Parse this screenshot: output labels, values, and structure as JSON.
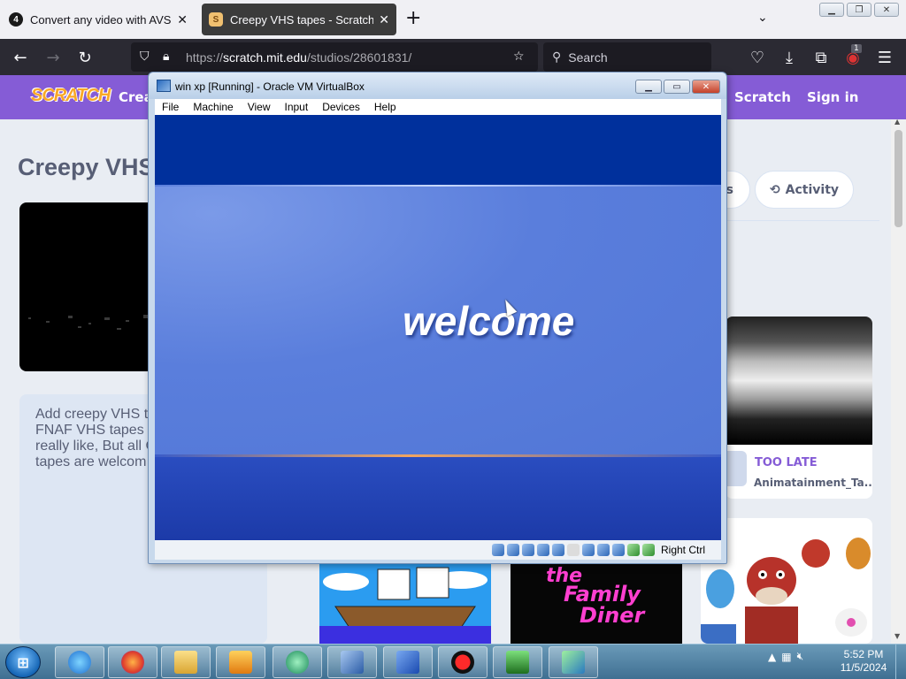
{
  "browser": {
    "tabs": [
      {
        "title": "Convert any video with AVS Fre",
        "favicon": "avs-icon"
      },
      {
        "title": "Creepy VHS tapes - Scratch Stu",
        "favicon": "scratch-icon"
      }
    ],
    "new_tab_label": "+",
    "url_host": "scratch.mit.edu",
    "url_prefix": "https://",
    "url_path": "/studios/28601831/",
    "search_placeholder": "Search",
    "extension_badge": "1"
  },
  "scratch": {
    "logo": "SCRATCH",
    "create": "Crea",
    "join": "Scratch",
    "signin": "Sign in",
    "studio_title": "Creepy VHS",
    "description_lines": [
      "Add creepy VHS t",
      "FNAF VHS tapes",
      "really like, But all C",
      "tapes are welcom"
    ],
    "tab_partial": "s",
    "tab_activity": "Activity",
    "projects": [
      {
        "title": "TOO LATE",
        "author": "Animatainment_Ta..."
      }
    ]
  },
  "vbox": {
    "title": "win xp [Running] - Oracle VM VirtualBox",
    "menu": [
      "File",
      "Machine",
      "View",
      "Input",
      "Devices",
      "Help"
    ],
    "welcome_text": "welcome",
    "host_key": "Right Ctrl"
  },
  "taskbar": {
    "time": "5:52 PM",
    "date": "11/5/2024"
  },
  "colors": {
    "scratch_purple": "#855cd6",
    "xp_blue": "#5a7edc",
    "firefox_dark": "#2b2a33"
  }
}
